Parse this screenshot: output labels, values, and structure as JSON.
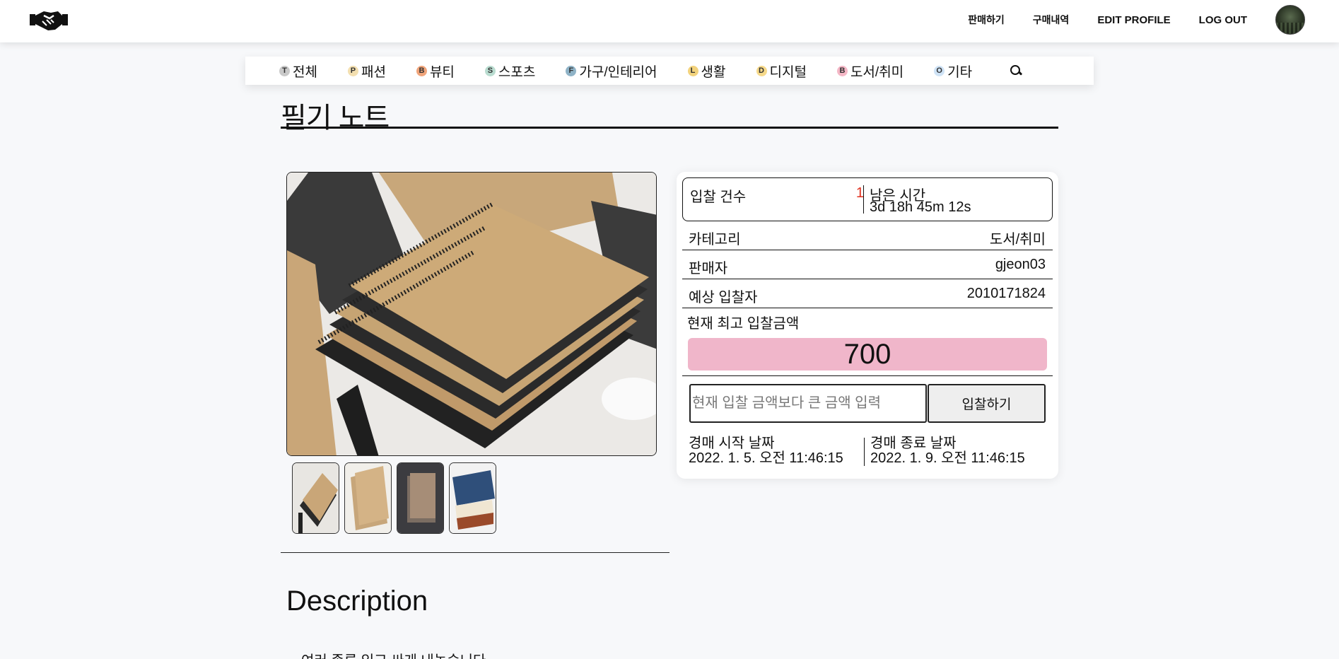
{
  "header": {
    "nav": [
      {
        "label": "판매하기"
      },
      {
        "label": "구매내역"
      },
      {
        "label": "EDIT PROFILE"
      },
      {
        "label": "LOG OUT"
      }
    ]
  },
  "categories": [
    {
      "badge": "T",
      "label": "전체",
      "color": "#c9c9c9"
    },
    {
      "badge": "P",
      "label": "패션",
      "color": "#f3dfb0"
    },
    {
      "badge": "B",
      "label": "뷰티",
      "color": "#f0a47a"
    },
    {
      "badge": "S",
      "label": "스포츠",
      "color": "#b9dcd0"
    },
    {
      "badge": "F",
      "label": "가구/인테리어",
      "color": "#8fb3c7"
    },
    {
      "badge": "L",
      "label": "생활",
      "color": "#f2d27c"
    },
    {
      "badge": "D",
      "label": "디지털",
      "color": "#f6d98a"
    },
    {
      "badge": "B",
      "label": "도서/취미",
      "color": "#f4b7c6"
    },
    {
      "badge": "O",
      "label": "기타",
      "color": "#cfe3f6"
    }
  ],
  "product": {
    "title": "필기 노트"
  },
  "auction": {
    "bid_count_label": "입찰 건수",
    "bid_count": "1",
    "remaining_label": "남은 시간",
    "remaining": "3d 18h 45m 12s",
    "rows": [
      {
        "key": "카테고리",
        "value": "도서/취미"
      },
      {
        "key": "판매자",
        "value": "gjeon03"
      },
      {
        "key": "예상 입찰자",
        "value": "2010171824"
      }
    ],
    "current_label": "현재 최고 입찰금액",
    "current_price": "700",
    "input_placeholder": "현재 입찰 금액보다 큰 금액 입력",
    "bid_button": "입찰하기",
    "start_label": "경매 시작 날짜",
    "start_date": "2022. 1. 5. 오전 11:46:15",
    "end_label": "경매 종료 날짜",
    "end_date": "2022. 1. 9. 오전 11:46:15"
  },
  "description": {
    "heading": "Description",
    "body": "여러 종류 있고 싸게 내놓습니다"
  }
}
